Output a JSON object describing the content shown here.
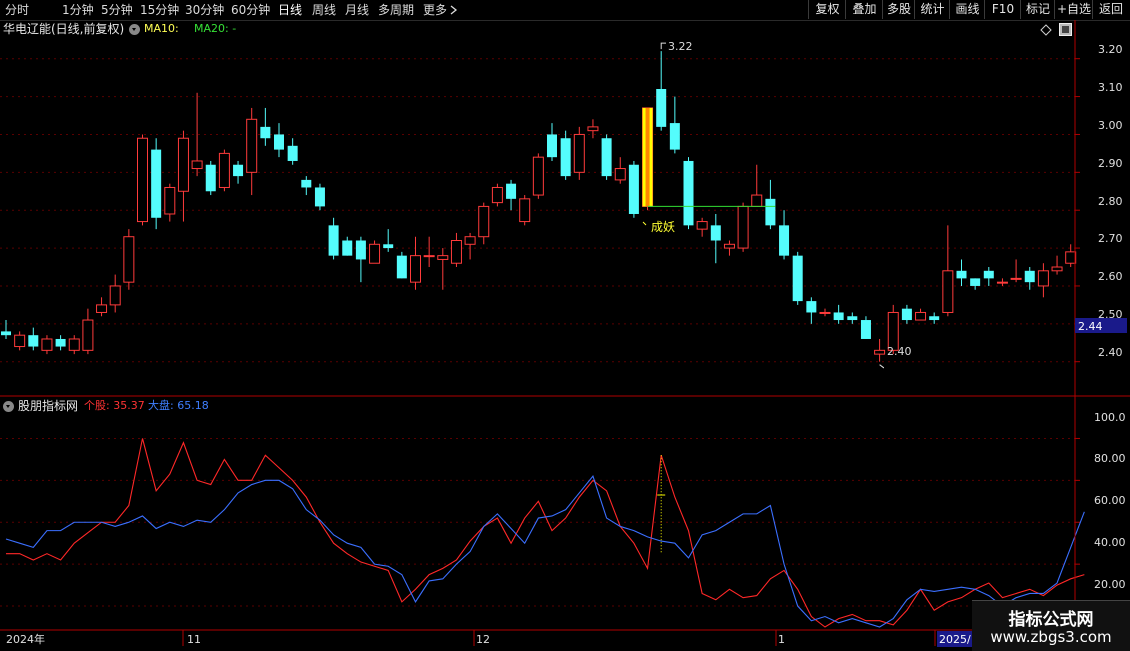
{
  "toolbar": {
    "timeframes": [
      "分时",
      "1分钟",
      "5分钟",
      "15分钟",
      "30分钟",
      "60分钟",
      "日线",
      "周线",
      "月线",
      "多周期",
      "更多"
    ],
    "active_timeframe": "日线",
    "right_buttons": [
      "复权",
      "叠加",
      "多股",
      "统计",
      "画线",
      "F10",
      "标记",
      "+自选",
      "返回"
    ]
  },
  "main_chart": {
    "title": "华电辽能(日线,前复权)",
    "ma10_label": "MA10:",
    "ma20_label": "MA20: -",
    "price_ticks": [
      "3.20",
      "3.10",
      "3.00",
      "2.90",
      "2.80",
      "2.70",
      "2.60",
      "2.50",
      "2.40"
    ],
    "current_price_tag": "2.44",
    "high_annotation": "3.22",
    "low_annotation": "2.40",
    "signal_label": "成妖"
  },
  "indicator": {
    "title": "股朋指标网",
    "stock_label": "个股: 35.37",
    "market_label": "大盘: 65.18",
    "ticks": [
      "100.0",
      "80.00",
      "60.00",
      "40.00",
      "20.00"
    ]
  },
  "date_axis": {
    "labels": [
      "2024年",
      "11",
      "12",
      "1",
      "2025/"
    ]
  },
  "watermark": {
    "line1": "指标公式网",
    "line2": "www.zbgs3.com"
  },
  "colors": {
    "up": "#ff3b3b",
    "down": "#54fcfc",
    "stock_line": "#ff2828",
    "market_line": "#3b6fff",
    "grid": "#5a0000",
    "axis": "#b00000",
    "price_tag_bg": "#1a1a8a",
    "signal_bar": "#ffff00"
  },
  "chart_data": [
    {
      "type": "candlestick",
      "title": "华电辽能(日线,前复权)",
      "ylim": [
        2.32,
        3.28
      ],
      "candles": [
        [
          2.48,
          2.47,
          2.51,
          2.46
        ],
        [
          2.44,
          2.47,
          2.48,
          2.43
        ],
        [
          2.47,
          2.44,
          2.49,
          2.43
        ],
        [
          2.43,
          2.46,
          2.47,
          2.42
        ],
        [
          2.46,
          2.44,
          2.47,
          2.43
        ],
        [
          2.43,
          2.46,
          2.47,
          2.42
        ],
        [
          2.43,
          2.51,
          2.54,
          2.42
        ],
        [
          2.53,
          2.55,
          2.57,
          2.52
        ],
        [
          2.55,
          2.6,
          2.63,
          2.53
        ],
        [
          2.61,
          2.73,
          2.75,
          2.59
        ],
        [
          2.77,
          2.99,
          3.0,
          2.76
        ],
        [
          2.96,
          2.78,
          2.99,
          2.75
        ],
        [
          2.79,
          2.86,
          2.87,
          2.77
        ],
        [
          2.85,
          2.99,
          3.01,
          2.77
        ],
        [
          2.91,
          2.93,
          3.11,
          2.89
        ],
        [
          2.92,
          2.85,
          2.93,
          2.84
        ],
        [
          2.86,
          2.95,
          2.96,
          2.85
        ],
        [
          2.92,
          2.89,
          2.93,
          2.87
        ],
        [
          2.9,
          3.04,
          3.07,
          2.84
        ],
        [
          3.02,
          2.99,
          3.07,
          2.97
        ],
        [
          3.0,
          2.96,
          3.03,
          2.94
        ],
        [
          2.97,
          2.93,
          2.99,
          2.92
        ],
        [
          2.88,
          2.86,
          2.89,
          2.84
        ],
        [
          2.86,
          2.81,
          2.87,
          2.8
        ],
        [
          2.76,
          2.68,
          2.78,
          2.67
        ],
        [
          2.72,
          2.68,
          2.73,
          2.68
        ],
        [
          2.72,
          2.67,
          2.73,
          2.61
        ],
        [
          2.66,
          2.71,
          2.72,
          2.66
        ],
        [
          2.71,
          2.7,
          2.75,
          2.69
        ],
        [
          2.68,
          2.62,
          2.69,
          2.62
        ],
        [
          2.61,
          2.68,
          2.73,
          2.59
        ],
        [
          2.68,
          2.68,
          2.73,
          2.65
        ],
        [
          2.67,
          2.68,
          2.7,
          2.59
        ],
        [
          2.66,
          2.72,
          2.74,
          2.65
        ],
        [
          2.71,
          2.73,
          2.74,
          2.67
        ],
        [
          2.73,
          2.81,
          2.82,
          2.71
        ],
        [
          2.82,
          2.86,
          2.87,
          2.81
        ],
        [
          2.87,
          2.83,
          2.88,
          2.8
        ],
        [
          2.77,
          2.83,
          2.84,
          2.76
        ],
        [
          2.84,
          2.94,
          2.95,
          2.83
        ],
        [
          3.0,
          2.94,
          3.03,
          2.93
        ],
        [
          2.99,
          2.89,
          3.01,
          2.88
        ],
        [
          2.9,
          3.0,
          3.02,
          2.88
        ],
        [
          3.01,
          3.02,
          3.04,
          2.99
        ],
        [
          2.99,
          2.89,
          3.0,
          2.88
        ],
        [
          2.88,
          2.91,
          2.94,
          2.87
        ],
        [
          2.92,
          2.79,
          2.93,
          2.78
        ],
        [
          2.81,
          3.07,
          3.07,
          2.8
        ],
        [
          3.12,
          3.02,
          3.22,
          3.01
        ],
        [
          3.03,
          2.96,
          3.1,
          2.95
        ],
        [
          2.93,
          2.76,
          2.94,
          2.75
        ],
        [
          2.75,
          2.77,
          2.78,
          2.73
        ],
        [
          2.76,
          2.72,
          2.79,
          2.66
        ],
        [
          2.7,
          2.71,
          2.72,
          2.68
        ],
        [
          2.7,
          2.81,
          2.82,
          2.69
        ],
        [
          2.81,
          2.84,
          2.92,
          2.81
        ],
        [
          2.83,
          2.76,
          2.88,
          2.75
        ],
        [
          2.76,
          2.68,
          2.8,
          2.67
        ],
        [
          2.68,
          2.56,
          2.69,
          2.55
        ],
        [
          2.56,
          2.53,
          2.57,
          2.5
        ],
        [
          2.53,
          2.53,
          2.54,
          2.52
        ],
        [
          2.53,
          2.51,
          2.55,
          2.5
        ],
        [
          2.52,
          2.51,
          2.53,
          2.5
        ],
        [
          2.51,
          2.46,
          2.52,
          2.46
        ],
        [
          2.42,
          2.43,
          2.46,
          2.4
        ],
        [
          2.43,
          2.53,
          2.55,
          2.42
        ],
        [
          2.54,
          2.51,
          2.55,
          2.5
        ],
        [
          2.51,
          2.53,
          2.54,
          2.51
        ],
        [
          2.52,
          2.51,
          2.53,
          2.5
        ],
        [
          2.53,
          2.64,
          2.76,
          2.52
        ],
        [
          2.64,
          2.62,
          2.67,
          2.6
        ],
        [
          2.62,
          2.6,
          2.62,
          2.59
        ],
        [
          2.64,
          2.62,
          2.65,
          2.6
        ],
        [
          2.61,
          2.61,
          2.62,
          2.6
        ],
        [
          2.62,
          2.62,
          2.67,
          2.61
        ],
        [
          2.64,
          2.61,
          2.65,
          2.59
        ],
        [
          2.6,
          2.64,
          2.66,
          2.57
        ],
        [
          2.64,
          2.65,
          2.68,
          2.63
        ],
        [
          2.66,
          2.69,
          2.71,
          2.65
        ]
      ],
      "high_label": "3.22",
      "low_label": "2.40"
    },
    {
      "type": "line",
      "title": "股朋指标网",
      "ylim": [
        10,
        105
      ],
      "series": [
        {
          "name": "个股",
          "color": "#ff2828",
          "values": [
            45,
            45,
            42,
            45,
            42,
            50,
            55,
            60,
            60,
            68,
            100,
            75,
            83,
            98,
            80,
            78,
            90,
            80,
            80,
            92,
            86,
            80,
            72,
            60,
            50,
            45,
            41,
            39,
            37,
            22,
            28,
            35,
            38,
            42,
            51,
            58,
            62,
            50,
            62,
            70,
            56,
            62,
            72,
            80,
            75,
            58,
            50,
            38,
            92,
            72,
            56,
            26,
            23,
            28,
            24,
            25,
            33,
            37,
            28,
            15,
            10,
            14,
            16,
            13,
            13,
            11,
            18,
            28,
            18,
            22,
            24,
            28,
            31,
            24,
            26,
            28,
            25,
            30,
            33,
            35
          ],
          "highlight_index": 48
        },
        {
          "name": "大盘",
          "color": "#3b6fff",
          "values": [
            52,
            50,
            48,
            56,
            56,
            60,
            60,
            60,
            58,
            60,
            63,
            57,
            60,
            58,
            61,
            60,
            66,
            74,
            78,
            80,
            80,
            76,
            66,
            61,
            54,
            50,
            48,
            40,
            39,
            35,
            22,
            32,
            33,
            40,
            46,
            58,
            64,
            57,
            50,
            62,
            63,
            66,
            74,
            82,
            62,
            58,
            56,
            53,
            51,
            50,
            43,
            54,
            56,
            60,
            64,
            64,
            68,
            40,
            20,
            13,
            15,
            12,
            14,
            12,
            10,
            14,
            23,
            28,
            27,
            28,
            29,
            28,
            25,
            20,
            24,
            26,
            26,
            31,
            48,
            65
          ]
        }
      ]
    }
  ]
}
